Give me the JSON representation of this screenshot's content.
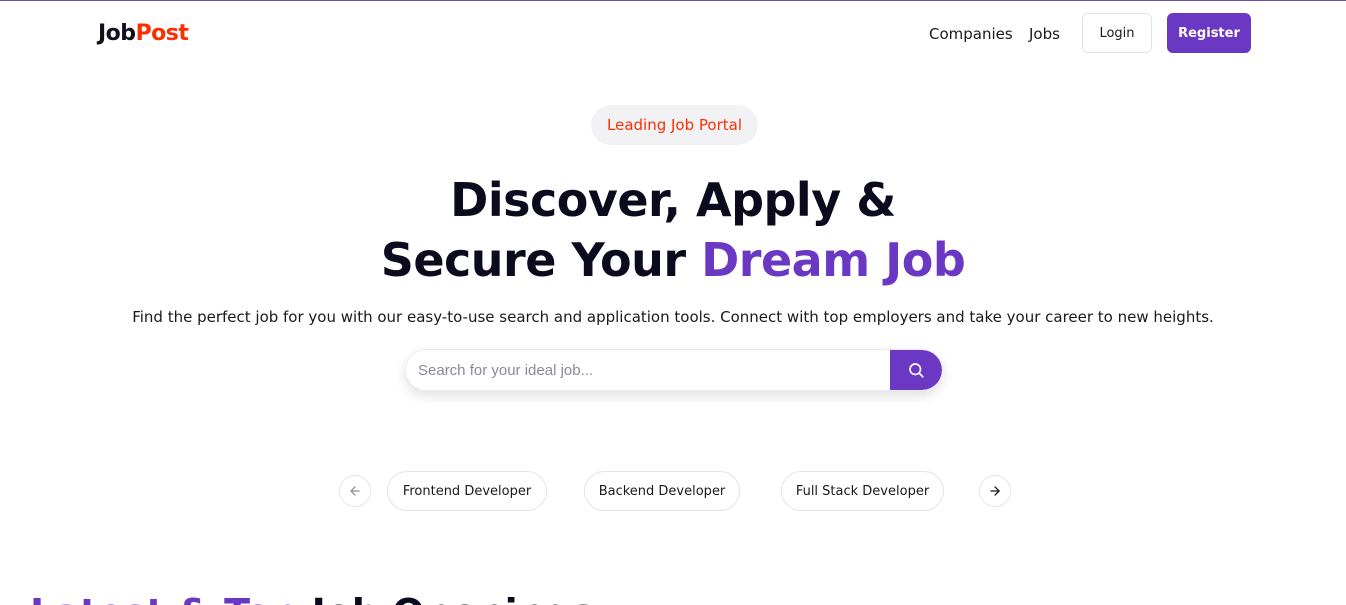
{
  "brand": {
    "logo_part1": "Job",
    "logo_part2": "Post"
  },
  "nav": {
    "companies_label": "Companies",
    "jobs_label": "Jobs",
    "login_label": "Login",
    "register_label": "Register"
  },
  "hero": {
    "badge": "Leading Job Portal",
    "headline_line1": "Discover, Apply &",
    "headline_line2_plain": "Secure Your ",
    "headline_line2_accent": "Dream Job",
    "subtitle": "Find the perfect job for you with our easy-to-use search and application tools. Connect with top employers and take your career to new heights."
  },
  "search": {
    "placeholder": "Search for your ideal job...",
    "value": ""
  },
  "categories": {
    "items": [
      "Frontend Developer",
      "Backend Developer",
      "Full Stack Developer"
    ],
    "prev_icon": "arrow-left-icon",
    "next_icon": "arrow-right-icon"
  },
  "latest": {
    "title_accent": "Latest & Top",
    "title_plain": " Job Openings"
  },
  "colors": {
    "accent": "#6a38c2",
    "brand_red": "#f83002",
    "text_dark": "#0b0b1e"
  }
}
